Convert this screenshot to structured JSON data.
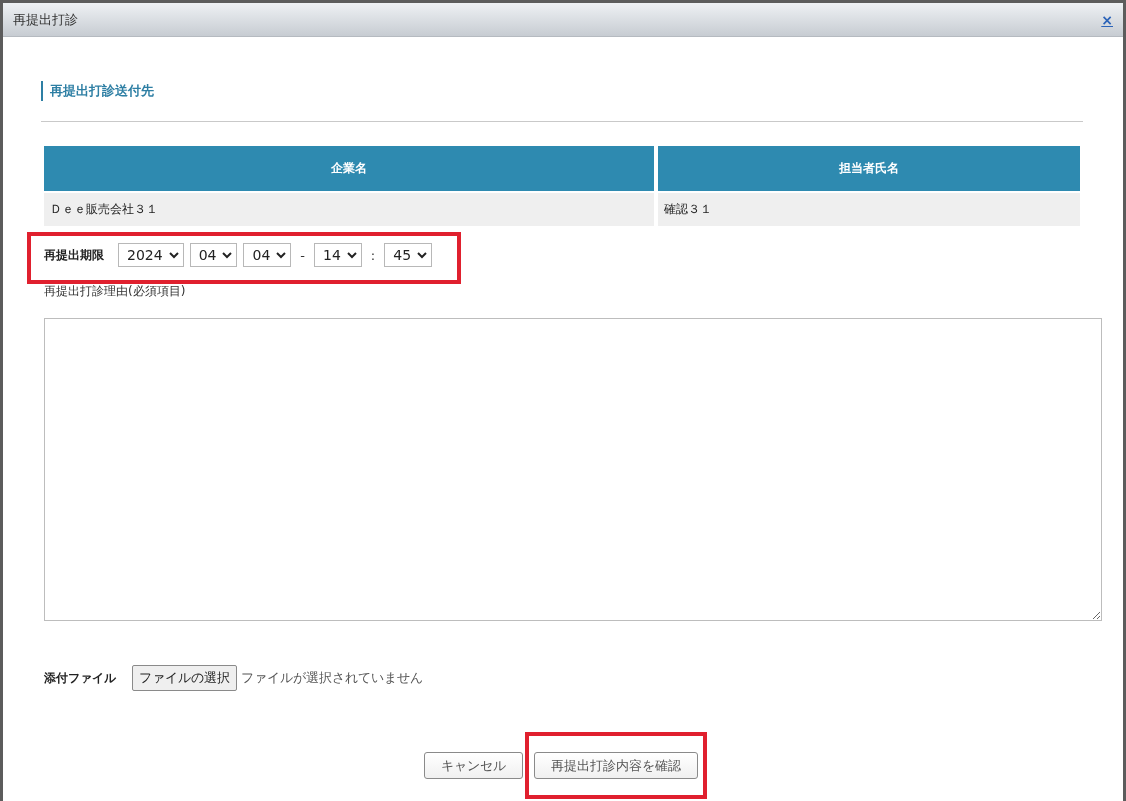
{
  "window": {
    "title": "再提出打診",
    "close": "×"
  },
  "section_title": "再提出打診送付先",
  "table": {
    "columns": [
      "企業名",
      "担当者氏名"
    ],
    "rows": [
      [
        "Ｄｅｅ販売会社３１",
        "確認３１"
      ]
    ]
  },
  "deadline": {
    "label": "再提出期限",
    "highlighted": true,
    "parts": [
      {
        "kind": "select",
        "value": "2024"
      },
      {
        "kind": "select",
        "value": "04"
      },
      {
        "kind": "select",
        "value": "04"
      },
      {
        "kind": "separator",
        "value": "-"
      },
      {
        "kind": "select",
        "value": "14"
      },
      {
        "kind": "separator",
        "value": ":"
      },
      {
        "kind": "select",
        "value": "45"
      }
    ]
  },
  "reason": {
    "label": "再提出打診理由(必須項目)"
  },
  "attachment": {
    "label": "添付ファイル",
    "button": "ファイルの選択",
    "status": "ファイルが選択されていません"
  },
  "buttons": [
    {
      "label": "キャンセル",
      "highlighted": false
    },
    {
      "label": "再提出打診内容を確認",
      "highlighted": true
    }
  ]
}
